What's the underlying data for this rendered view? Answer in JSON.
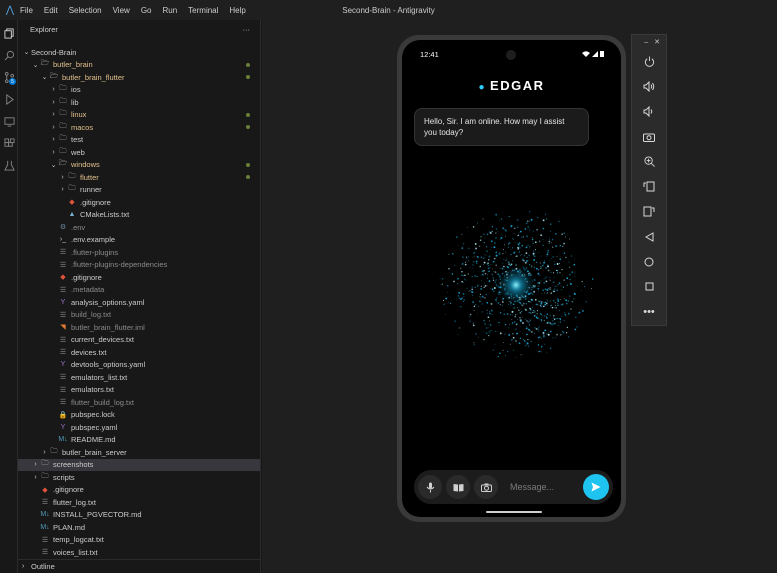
{
  "app": {
    "logo": "antigravity-logo",
    "window_title": "Second-Brain - Antigravity"
  },
  "menu": [
    "File",
    "Edit",
    "Selection",
    "View",
    "Go",
    "Run",
    "Terminal",
    "Help"
  ],
  "activity_bar": {
    "icons": [
      "explorer-icon",
      "search-icon",
      "source-control-icon",
      "run-debug-icon",
      "remote-icon",
      "extensions-icon",
      "testing-icon"
    ],
    "source_control_badge": "5"
  },
  "explorer": {
    "title": "Explorer",
    "more": "···",
    "tree": [
      {
        "label": "Second-Brain",
        "indent": 0,
        "kind": "folder-open",
        "color": "light",
        "dot": false
      },
      {
        "label": "butler_brain",
        "indent": 1,
        "kind": "folder-open",
        "color": "orange",
        "dot": true
      },
      {
        "label": "butler_brain_flutter",
        "indent": 2,
        "kind": "folder-open",
        "color": "orange",
        "dot": true
      },
      {
        "label": "ios",
        "indent": 3,
        "kind": "folder",
        "color": "light",
        "dot": false
      },
      {
        "label": "lib",
        "indent": 3,
        "kind": "folder",
        "color": "light",
        "dot": false
      },
      {
        "label": "linux",
        "indent": 3,
        "kind": "folder",
        "color": "orange",
        "dot": true
      },
      {
        "label": "macos",
        "indent": 3,
        "kind": "folder",
        "color": "orange",
        "dot": true
      },
      {
        "label": "test",
        "indent": 3,
        "kind": "folder",
        "color": "light",
        "dot": false
      },
      {
        "label": "web",
        "indent": 3,
        "kind": "folder",
        "color": "light",
        "dot": false
      },
      {
        "label": "windows",
        "indent": 3,
        "kind": "folder-open",
        "color": "orange",
        "dot": true
      },
      {
        "label": "flutter",
        "indent": 4,
        "kind": "folder",
        "color": "orange",
        "dot": true
      },
      {
        "label": "runner",
        "indent": 4,
        "kind": "folder",
        "color": "light",
        "dot": false
      },
      {
        "label": ".gitignore",
        "indent": 4,
        "kind": "git",
        "color": "light",
        "dot": false
      },
      {
        "label": "CMakeLists.txt",
        "indent": 4,
        "kind": "cmake",
        "color": "light",
        "dot": false
      },
      {
        "label": ".env",
        "indent": 3,
        "kind": "gear",
        "color": "gray",
        "dot": false
      },
      {
        "label": ".env.example",
        "indent": 3,
        "kind": "shell",
        "color": "light",
        "dot": false
      },
      {
        "label": ".flutter-plugins",
        "indent": 3,
        "kind": "file",
        "color": "gray",
        "dot": false
      },
      {
        "label": ".flutter-plugins-dependencies",
        "indent": 3,
        "kind": "file",
        "color": "gray",
        "dot": false
      },
      {
        "label": ".gitignore",
        "indent": 3,
        "kind": "git",
        "color": "light",
        "dot": false
      },
      {
        "label": ".metadata",
        "indent": 3,
        "kind": "file",
        "color": "gray",
        "dot": false
      },
      {
        "label": "analysis_options.yaml",
        "indent": 3,
        "kind": "yaml",
        "color": "light",
        "dot": false
      },
      {
        "label": "build_log.txt",
        "indent": 3,
        "kind": "file",
        "color": "gray",
        "dot": false
      },
      {
        "label": "butler_brain_flutter.iml",
        "indent": 3,
        "kind": "rss",
        "color": "gray",
        "dot": false
      },
      {
        "label": "current_devices.txt",
        "indent": 3,
        "kind": "file",
        "color": "light",
        "dot": false
      },
      {
        "label": "devices.txt",
        "indent": 3,
        "kind": "file",
        "color": "light",
        "dot": false
      },
      {
        "label": "devtools_options.yaml",
        "indent": 3,
        "kind": "yaml",
        "color": "light",
        "dot": false
      },
      {
        "label": "emulators_list.txt",
        "indent": 3,
        "kind": "file",
        "color": "light",
        "dot": false
      },
      {
        "label": "emulators.txt",
        "indent": 3,
        "kind": "file",
        "color": "light",
        "dot": false
      },
      {
        "label": "flutter_build_log.txt",
        "indent": 3,
        "kind": "file",
        "color": "gray",
        "dot": false
      },
      {
        "label": "pubspec.lock",
        "indent": 3,
        "kind": "lock",
        "color": "light",
        "dot": false
      },
      {
        "label": "pubspec.yaml",
        "indent": 3,
        "kind": "yaml",
        "color": "light",
        "dot": false
      },
      {
        "label": "README.md",
        "indent": 3,
        "kind": "md",
        "color": "light",
        "dot": false
      },
      {
        "label": "butler_brain_server",
        "indent": 2,
        "kind": "folder",
        "color": "light",
        "dot": false
      },
      {
        "label": "screenshots",
        "indent": 1,
        "kind": "folder",
        "color": "light",
        "dot": false,
        "selected": true
      },
      {
        "label": "scripts",
        "indent": 1,
        "kind": "folder",
        "color": "light",
        "dot": false
      },
      {
        "label": ".gitignore",
        "indent": 1,
        "kind": "git",
        "color": "light",
        "dot": false
      },
      {
        "label": "flutter_log.txt",
        "indent": 1,
        "kind": "file",
        "color": "light",
        "dot": false
      },
      {
        "label": "INSTALL_PGVECTOR.md",
        "indent": 1,
        "kind": "md",
        "color": "light",
        "dot": false
      },
      {
        "label": "PLAN.md",
        "indent": 1,
        "kind": "md",
        "color": "light",
        "dot": false
      },
      {
        "label": "temp_logcat.txt",
        "indent": 1,
        "kind": "file",
        "color": "light",
        "dot": false
      },
      {
        "label": "voices_list.txt",
        "indent": 1,
        "kind": "file",
        "color": "light",
        "dot": false
      }
    ],
    "outline_label": "Outline"
  },
  "phone": {
    "time": "12:41",
    "app_title": "EDGAR",
    "message": "Hello, Sir. I am online. How may I assist you today?",
    "input_placeholder": "Message...",
    "accent": "#1ec4ef"
  },
  "emulator_toolbar": {
    "icons": [
      "power-icon",
      "volume-up-icon",
      "volume-down-icon",
      "camera-icon",
      "zoom-icon",
      "rotate-left-icon",
      "rotate-right-icon",
      "back-icon",
      "home-icon",
      "overview-icon",
      "more-icon"
    ]
  }
}
